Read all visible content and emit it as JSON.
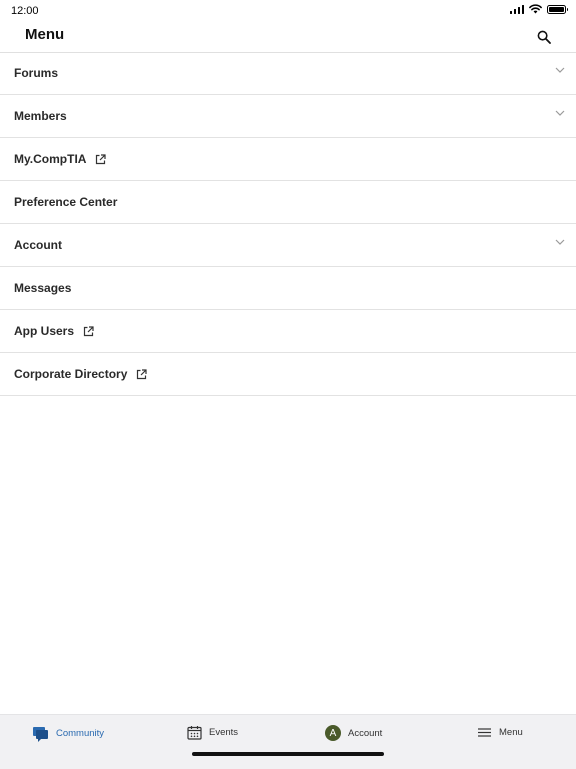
{
  "status_bar": {
    "time": "12:00"
  },
  "header": {
    "title": "Menu"
  },
  "menu": {
    "items": [
      {
        "label": "Forums",
        "trailing": "chevron"
      },
      {
        "label": "Members",
        "trailing": "chevron"
      },
      {
        "label": "My.CompTIA",
        "trailing": "external-link"
      },
      {
        "label": "Preference Center",
        "trailing": "none"
      },
      {
        "label": "Account",
        "trailing": "chevron"
      },
      {
        "label": "Messages",
        "trailing": "none"
      },
      {
        "label": "App Users",
        "trailing": "external-link"
      },
      {
        "label": "Corporate Directory",
        "trailing": "external-link"
      }
    ]
  },
  "tab_bar": {
    "active": "Community",
    "tabs": [
      {
        "label": "Community",
        "icon": "chat-bubbles-icon"
      },
      {
        "label": "Events",
        "icon": "calendar-icon"
      },
      {
        "label": "Account",
        "icon": "avatar",
        "avatar_letter": "A"
      },
      {
        "label": "Menu",
        "icon": "hamburger-icon"
      }
    ]
  },
  "colors": {
    "accent": "#2a6ab0",
    "avatar_bg": "#4a5a2a",
    "tab_bar_bg": "#f1f1f3",
    "divider": "#e2e2e2"
  }
}
